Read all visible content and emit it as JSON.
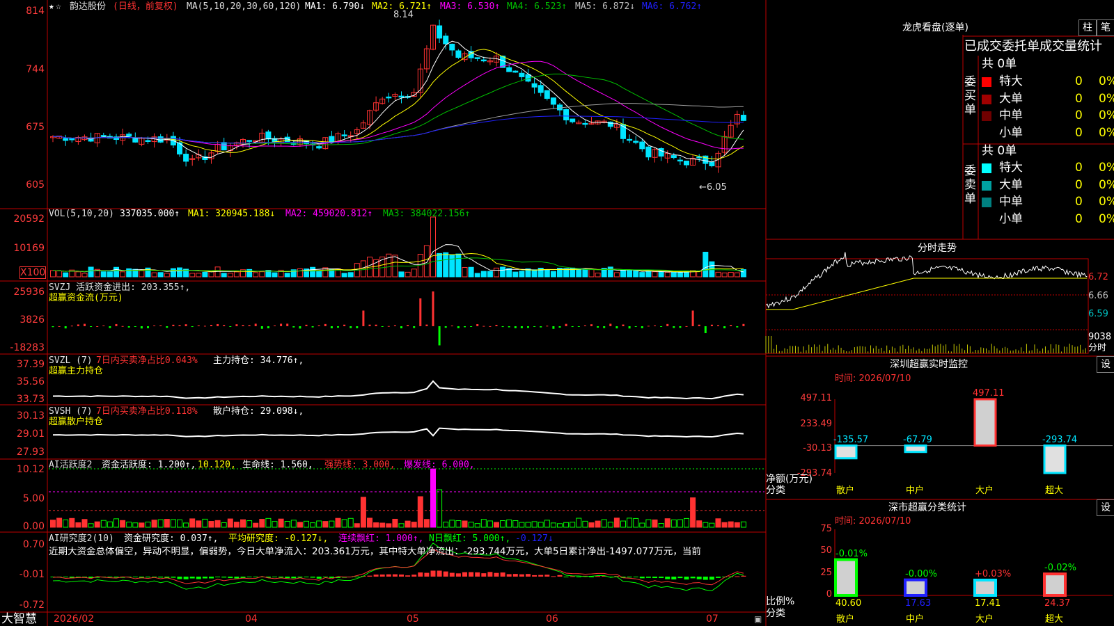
{
  "colors": {
    "up": "#ff3232",
    "down": "#00e5ff",
    "grid": "#c00000",
    "ma1": "#ffffff",
    "ma2": "#ffff00",
    "ma3": "#ff00ff",
    "ma4": "#00c000",
    "ma5": "#a0a0a0",
    "ma6": "#2020ff",
    "green": "#00ff00",
    "yellow": "#ffff00",
    "white": "#ffffff",
    "red": "#ff3232"
  },
  "price_axis": [
    "814",
    "744",
    "675",
    "605"
  ],
  "price_header": {
    "name": "韵达股份",
    "period": "(日线，前复权)",
    "ma_spec": "MA(5,10,20,30,60,120)",
    "ma1": "MA1: 6.790↓",
    "ma2": "MA2: 6.721↑",
    "ma3": "MA3: 6.530↑",
    "ma4": "MA4: 6.523↑",
    "ma5": "MA5: 6.872↓",
    "ma6": "MA6: 6.762↑"
  },
  "price_annotations": {
    "high": "8.14",
    "low": "←6.05"
  },
  "vol_axis": [
    "20592",
    "10169",
    "X100"
  ],
  "vol_header": {
    "spec": "VOL(5,10,20)",
    "value": "337035.000↑",
    "ma1": "MA1: 320945.188↓",
    "ma2": "MA2: 459020.812↑",
    "ma3": "MA3: 384022.156↑"
  },
  "svzj_axis": [
    "25936",
    "3826",
    "-18283"
  ],
  "svzj_header": {
    "line1": "SVZJ  活跃资金进出: 203.355↑,",
    "line2": "超赢资金流(万元)"
  },
  "svzl_axis": [
    "37.39",
    "35.56",
    "33.73"
  ],
  "svzl_header": {
    "spec": "SVZL (7)",
    "pct": "7日内买卖净占比0.043%",
    "hold": "主力持仓: 34.776↑,",
    "line2": "超赢主力持仓"
  },
  "svsh_axis": [
    "30.13",
    "29.01",
    "27.93"
  ],
  "svsh_header": {
    "spec": "SVSH (7)",
    "pct": "7日内买卖净占比0.118%",
    "hold": "散户持仓: 29.098↓,",
    "line2": "超赢散户持仓"
  },
  "ai1_axis": [
    "10.12",
    "5.00",
    "0.00"
  ],
  "ai1_header": {
    "spec": "AI活跃度2",
    "act": "资金活跃度: 1.200↑,",
    "v2": "10.120,",
    "life": "生命线: 1.560,",
    "strong": "强势线: 3.000,",
    "burst": "爆发线: 6.000,"
  },
  "ai2_axis": [
    "0.70",
    "-0.01",
    "-0.72"
  ],
  "ai2_header": {
    "spec": "AI研究度2(10)",
    "res": "资金研究度: 0.037↑,",
    "avg": "平均研究度: -0.127↓,",
    "cont": "连续飘红: 1.000↑,",
    "nday": "N日飘红: 5.000↑,",
    "last": "-0.127↓"
  },
  "ai2_text": "近期大资金总体偏空，异动不明显，偏弱势，今日大单净流入：203.361万元，其中特大单净流出：-293.744万元，大单5日累计净出-1497.077万元，当前",
  "date_axis": [
    "2026/02",
    "04",
    "05",
    "06",
    "07"
  ],
  "brand": "大智慧",
  "right": {
    "lhb_title": "龙虎看盘(逐单)",
    "btn_zhu": "柱",
    "btn_bi": "笔",
    "order_title": "已成交委托单成交量统计",
    "buy_label": "委买单",
    "sell_label": "委卖单",
    "buy_total": "共 0单",
    "sell_total": "共 0单",
    "buy_rows": [
      {
        "label": "特大",
        "count": "0",
        "pct": "0%",
        "color": "#ff0000"
      },
      {
        "label": "大单",
        "count": "0",
        "pct": "0%",
        "color": "#a00000"
      },
      {
        "label": "中单",
        "count": "0",
        "pct": "0%",
        "color": "#700000"
      },
      {
        "label": "小单",
        "count": "0",
        "pct": "0%",
        "color": "#000000"
      }
    ],
    "sell_rows": [
      {
        "label": "特大",
        "count": "0",
        "pct": "0%",
        "color": "#00ffff"
      },
      {
        "label": "大单",
        "count": "0",
        "pct": "0%",
        "color": "#00a0a0"
      },
      {
        "label": "中单",
        "count": "0",
        "pct": "0%",
        "color": "#008080"
      },
      {
        "label": "小单",
        "count": "0",
        "pct": "0%",
        "color": "#000000"
      }
    ],
    "intraday_title": "分时走势",
    "intraday_axis": [
      "6.72",
      "6.66",
      "6.59"
    ],
    "intraday_vol": "9038",
    "intraday_vol_unit": "分时",
    "sz_monitor_title": "深圳超赢实时监控",
    "sz_monitor_settings": "设",
    "sz_time": "时间: 2026/07/10",
    "sz_axis": [
      "497.11",
      "233.49",
      "-30.13",
      "-293.74"
    ],
    "sz_axis_label": "净额(万元)",
    "sz_cat_label": "分类",
    "sz_values": [
      {
        "cat": "散户",
        "val": "-135.57",
        "num": -135.57
      },
      {
        "cat": "中户",
        "val": "-67.79",
        "num": -67.79
      },
      {
        "cat": "大户",
        "val": "497.11",
        "num": 497.11
      },
      {
        "cat": "超大",
        "val": "-293.74",
        "num": -293.74
      }
    ],
    "sz_class_title": "深市超赢分类统计",
    "sz_class_settings": "设",
    "class_time": "时间: 2026/07/10",
    "class_axis": [
      "75",
      "50",
      "25",
      "0"
    ],
    "class_axis_label": "比例%",
    "class_cat_label": "分类",
    "class_values": [
      {
        "cat": "散户",
        "delta": "-0.01%",
        "val": "40.60",
        "num": 40.6
      },
      {
        "cat": "中户",
        "delta": "-0.00%",
        "val": "17.63",
        "num": 17.63
      },
      {
        "cat": "大户",
        "delta": "+0.03%",
        "val": "17.41",
        "num": 17.41
      },
      {
        "cat": "超大",
        "delta": "-0.02%",
        "val": "24.37",
        "num": 24.37
      }
    ]
  }
}
